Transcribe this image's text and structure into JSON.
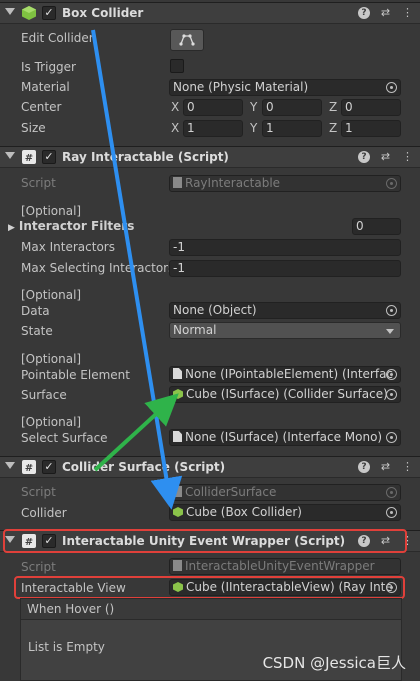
{
  "box_collider": {
    "title": "Box Collider",
    "edit_collider_label": "Edit Collider",
    "is_trigger_label": "Is Trigger",
    "material_label": "Material",
    "material_value": "None (Physic Material)",
    "center_label": "Center",
    "center": {
      "x": "0",
      "y": "0",
      "z": "0"
    },
    "size_label": "Size",
    "size": {
      "x": "1",
      "y": "1",
      "z": "1"
    }
  },
  "ray_interactable": {
    "title": "Ray Interactable (Script)",
    "script_label": "Script",
    "script_value": "RayInteractable",
    "optional_1": "[Optional]",
    "interactor_filters_label": "Interactor Filters",
    "interactor_filters_count": "0",
    "max_interactors_label": "Max Interactors",
    "max_interactors_value": "-1",
    "max_selecting_label": "Max Selecting Interactors",
    "max_selecting_value": "-1",
    "optional_2": "[Optional]",
    "data_label": "Data",
    "data_value": "None (Object)",
    "state_label": "State",
    "state_value": "Normal",
    "optional_3": "[Optional]",
    "pointable_label": "Pointable Element",
    "pointable_value": "None (IPointableElement) (Interfac",
    "surface_label": "Surface",
    "surface_value": "Cube (ISurface) (Collider Surface)",
    "optional_4": "[Optional]",
    "select_surface_label": "Select Surface",
    "select_surface_value": "None (ISurface) (Interface Mono)"
  },
  "collider_surface": {
    "title": "Collider Surface (Script)",
    "script_label": "Script",
    "script_value": "ColliderSurface",
    "collider_label": "Collider",
    "collider_value": "Cube (Box Collider)"
  },
  "event_wrapper": {
    "title": "Interactable Unity Event Wrapper (Script)",
    "script_label": "Script",
    "script_value": "InteractableUnityEventWrapper",
    "view_label": "Interactable View",
    "view_value": "Cube (IInteractableView) (Ray Inte",
    "when_hover_label": "When Hover ()",
    "list_empty": "List is Empty"
  },
  "header_icons": {
    "help": "?",
    "settings": "⇄",
    "menu": "⋮"
  },
  "watermark": "CSDN @Jessica巨人",
  "colors": {
    "blue_arrow": "#2e8ff0",
    "green_arrow": "#2fb34a",
    "highlight": "#e0403a"
  }
}
